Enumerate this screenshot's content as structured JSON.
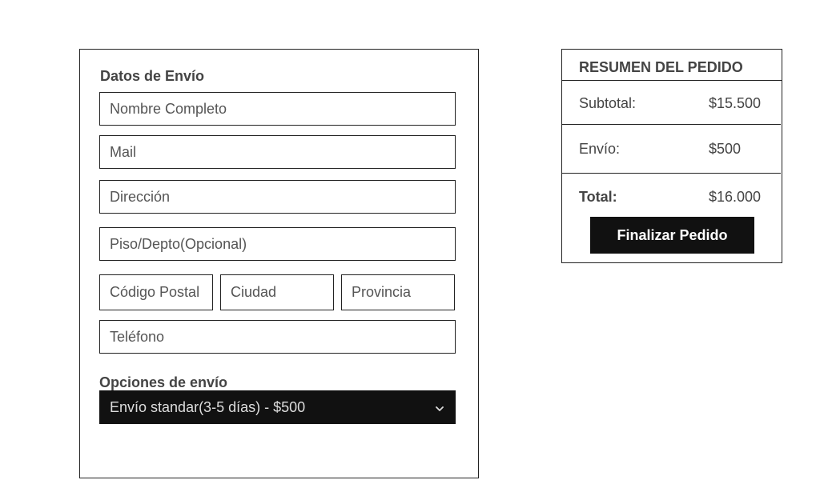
{
  "shipping_form": {
    "title": "Datos de Envío",
    "fields": {
      "full_name": {
        "placeholder": "Nombre Completo",
        "value": ""
      },
      "mail": {
        "placeholder": "Mail",
        "value": ""
      },
      "address": {
        "placeholder": "Dirección",
        "value": ""
      },
      "floor_apartment": {
        "placeholder": "Piso/Depto(Opcional)",
        "value": ""
      },
      "postal_code": {
        "placeholder": "Código Postal",
        "value": ""
      },
      "city": {
        "placeholder": "Ciudad",
        "value": ""
      },
      "province": {
        "placeholder": "Provincia",
        "value": ""
      },
      "phone": {
        "placeholder": "Teléfono",
        "value": ""
      }
    },
    "shipping_options": {
      "label": "Opciones de envío",
      "selected": "Envío standar(3-5 días) - $500"
    }
  },
  "order_summary": {
    "title": "RESUMEN DEL PEDIDO",
    "subtotal_label": "Subtotal:",
    "subtotal_value": "$15.500",
    "shipping_label": "Envío:",
    "shipping_value": "$500",
    "total_label": "Total:",
    "total_value": "$16.000",
    "finish_button": "Finalizar Pedido"
  }
}
